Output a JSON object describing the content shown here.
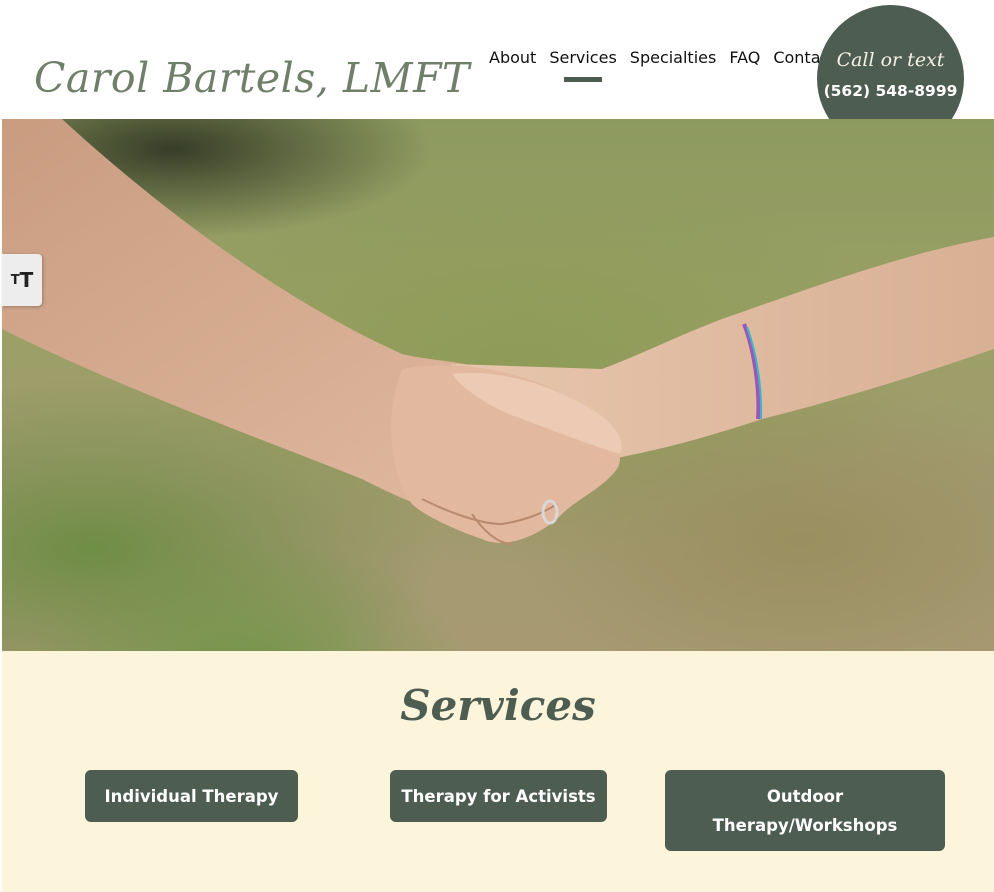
{
  "header": {
    "logo": "Carol Bartels, LMFT",
    "nav": [
      {
        "label": "About"
      },
      {
        "label": "Services"
      },
      {
        "label": "Specialties"
      },
      {
        "label": "FAQ"
      },
      {
        "label": "Contact"
      }
    ],
    "active_nav": "Services",
    "call": {
      "line1": "Call or text",
      "phone": "(562) 548-8999"
    }
  },
  "accessibility": {
    "font_size_icon": "text-size-icon",
    "small_glyph": "T",
    "big_glyph": "T"
  },
  "hero": {
    "image": "handshake-photo"
  },
  "services": {
    "title": "Services",
    "buttons": [
      {
        "label": "Individual Therapy"
      },
      {
        "label": "Therapy for Activists"
      },
      {
        "label": "Outdoor Therapy/Workshops"
      }
    ]
  },
  "colors": {
    "brand_green": "#4e5d51",
    "logo_green": "#6f7f6a",
    "cream": "#fdf4dc"
  }
}
